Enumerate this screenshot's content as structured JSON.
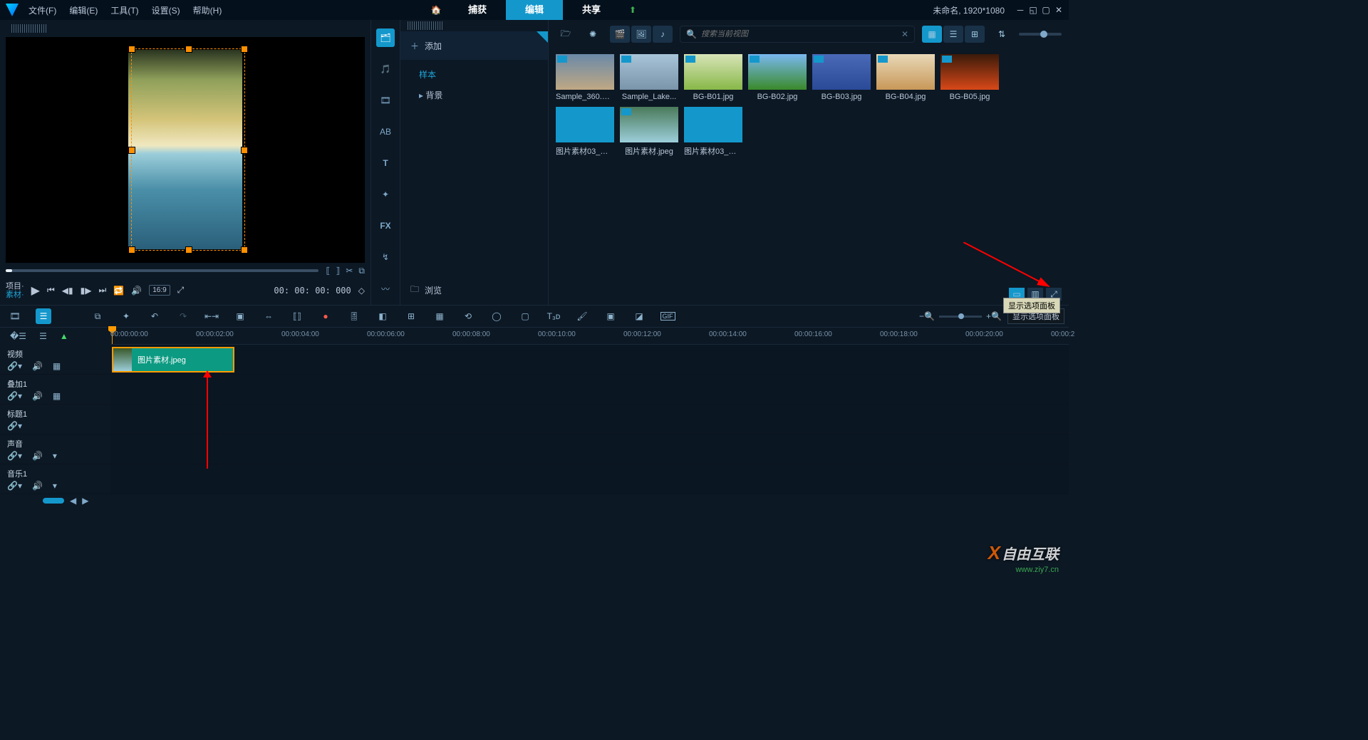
{
  "title": {
    "untitled": "未命名, 1920*1080"
  },
  "menu": {
    "file": "文件(F)",
    "edit": "编辑(E)",
    "tools": "工具(T)",
    "settings": "设置(S)",
    "help": "帮助(H)"
  },
  "tabs": {
    "capture": "捕获",
    "edit": "编辑",
    "share": "共享"
  },
  "preview": {
    "label1": "项目·",
    "label2": "素材·",
    "timecode": "00: 00: 00: 000",
    "ratio": "16:9"
  },
  "addpanel": {
    "add": "添加",
    "sample": "样本",
    "background": "背景",
    "browse": "浏览"
  },
  "library": {
    "search_placeholder": "搜索当前视图",
    "thumbs": [
      {
        "name": "Sample_360.m..."
      },
      {
        "name": "Sample_Lake..."
      },
      {
        "name": "BG-B01.jpg"
      },
      {
        "name": "BG-B02.jpg"
      },
      {
        "name": "BG-B03.jpg"
      },
      {
        "name": "BG-B04.jpg"
      },
      {
        "name": "BG-B05.jpg"
      },
      {
        "name": "图片素材03_副..."
      },
      {
        "name": "图片素材.jpeg"
      },
      {
        "name": "图片素材03_副..."
      }
    ],
    "tooltip": "显示选项面板",
    "options_label": "显示选项面板"
  },
  "ruler": {
    "ticks": [
      "00:00:00:00",
      "00:00:02:00",
      "00:00:04:00",
      "00:00:06:00",
      "00:00:08:00",
      "00:00:10:00",
      "00:00:12:00",
      "00:00:14:00",
      "00:00:16:00",
      "00:00:18:00",
      "00:00:20:00",
      "00:00:2"
    ]
  },
  "tracks": {
    "video": "视频",
    "overlay": "叠加1",
    "title": "标题1",
    "sound": "声音",
    "music": "音乐1",
    "clip_label": "图片素材.jpeg"
  },
  "watermark": {
    "main": "自由互联",
    "sub": "www.ziy7.cn"
  }
}
